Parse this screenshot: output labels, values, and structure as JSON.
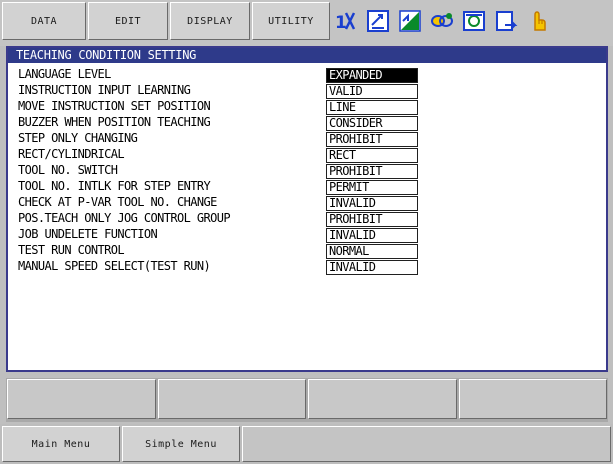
{
  "menu": {
    "data": "DATA",
    "edit": "EDIT",
    "display": "DISPLAY",
    "utility": "UTILITY"
  },
  "status_icons": [
    "robot-axis-icon",
    "edit-mode-icon",
    "signal-icon",
    "link-icon",
    "monitor-icon",
    "page-icon",
    "hand-pointer-icon"
  ],
  "panel": {
    "title": "TEACHING CONDITION SETTING",
    "rows": [
      {
        "label": "LANGUAGE LEVEL",
        "value": "EXPANDED",
        "selected": true
      },
      {
        "label": "INSTRUCTION INPUT LEARNING",
        "value": "VALID"
      },
      {
        "label": "MOVE INSTRUCTION SET POSITION",
        "value": "LINE"
      },
      {
        "label": "BUZZER WHEN POSITION TEACHING",
        "value": "CONSIDER"
      },
      {
        "label": "STEP ONLY CHANGING",
        "value": "PROHIBIT"
      },
      {
        "label": "RECT/CYLINDRICAL",
        "value": "RECT"
      },
      {
        "label": "TOOL NO. SWITCH",
        "value": "PROHIBIT"
      },
      {
        "label": "TOOL NO. INTLK FOR STEP ENTRY",
        "value": "PERMIT"
      },
      {
        "label": "CHECK AT P-VAR TOOL NO. CHANGE",
        "value": "INVALID"
      },
      {
        "label": "POS.TEACH ONLY JOG CONTROL GROUP",
        "value": "PROHIBIT"
      },
      {
        "label": "JOB UNDELETE FUNCTION",
        "value": "INVALID"
      },
      {
        "label": "TEST RUN CONTROL",
        "value": "NORMAL"
      },
      {
        "label": "MANUAL SPEED SELECT(TEST RUN)",
        "value": "INVALID"
      }
    ]
  },
  "bottom": {
    "main_menu": "Main Menu",
    "simple_menu": "Simple Menu"
  },
  "colors": {
    "title_bar": "#2e3a8a",
    "selected_bg": "#000000",
    "icon_blue": "#1a3fcf",
    "icon_green": "#0a8a2a",
    "icon_yellow": "#f5c400"
  }
}
